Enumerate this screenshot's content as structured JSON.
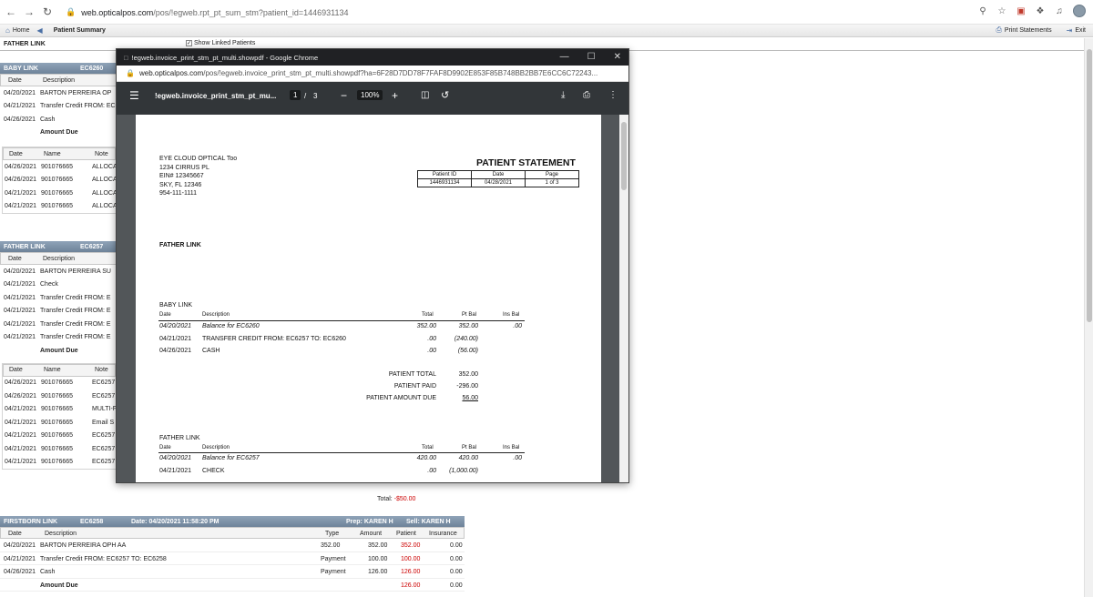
{
  "browser": {
    "url_domain": "web.opticalpos.com",
    "url_path": "/pos/!egweb.rpt_pt_sum_stm?patient_id=1446931134"
  },
  "apptoolbar": {
    "home": "Home",
    "patient_summary": "Patient Summary",
    "print_statements": "Print Statements",
    "exit": "Exit"
  },
  "father_link_bar": {
    "label": "FATHER LINK",
    "show_linked": "Show Linked Patients"
  },
  "left": {
    "baby_title": "BABY LINK",
    "baby_code": "EC6260",
    "col_date": "Date",
    "col_desc": "Description",
    "col_name": "Name",
    "col_note": "Note",
    "baby_rows": [
      {
        "date": "04/20/2021",
        "desc": "BARTON PERREIRA OP"
      },
      {
        "date": "04/21/2021",
        "desc": "Transfer Credit FROM: EC"
      },
      {
        "date": "04/26/2021",
        "desc": "Cash"
      }
    ],
    "amount_due": "Amount Due",
    "baby_pay_rows": [
      {
        "date": "04/26/2021",
        "name": "901076665",
        "note": "ALLOCA"
      },
      {
        "date": "04/26/2021",
        "name": "901076665",
        "note": "ALLOCA"
      },
      {
        "date": "04/21/2021",
        "name": "901076665",
        "note": "ALLOCA"
      },
      {
        "date": "04/21/2021",
        "name": "901076665",
        "note": "ALLOCA"
      }
    ],
    "father_title": "FATHER LINK",
    "father_code": "EC6257",
    "father_rows": [
      {
        "date": "04/20/2021",
        "desc": "BARTON PERREIRA SU"
      },
      {
        "date": "04/21/2021",
        "desc": "Check"
      },
      {
        "date": "04/21/2021",
        "desc": "Transfer Credit FROM: E"
      },
      {
        "date": "04/21/2021",
        "desc": "Transfer Credit FROM: E"
      },
      {
        "date": "04/21/2021",
        "desc": "Transfer Credit FROM: E"
      },
      {
        "date": "04/21/2021",
        "desc": "Transfer Credit FROM: E"
      }
    ],
    "father_pay_rows": [
      {
        "date": "04/26/2021",
        "name": "901076665",
        "note": "EC6257"
      },
      {
        "date": "04/26/2021",
        "name": "901076665",
        "note": "EC6257"
      },
      {
        "date": "04/21/2021",
        "name": "901076665",
        "note": "MULTI-F"
      },
      {
        "date": "04/21/2021",
        "name": "901076665",
        "note": "Email S"
      },
      {
        "date": "04/21/2021",
        "name": "901076665",
        "note": "EC6257"
      },
      {
        "date": "04/21/2021",
        "name": "901076665",
        "note": "EC6257"
      },
      {
        "date": "04/21/2021",
        "name": "901076665",
        "note": "EC6257"
      }
    ]
  },
  "total": {
    "label": "Total:",
    "value": "-$50.00"
  },
  "firstborn": {
    "title": "FIRSTBORN LINK",
    "code": "EC6258",
    "date_label": "Date: 04/20/2021 11:58:20 PM",
    "prep": "Prep: KAREN H",
    "sell": "Sell: KAREN H",
    "cols": {
      "date": "Date",
      "desc": "Description",
      "type": "Type",
      "amount": "Amount",
      "patient": "Patient",
      "insurance": "Insurance"
    },
    "rows": [
      {
        "date": "04/20/2021",
        "desc": "BARTON PERREIRA OPH AA",
        "type": "352.00",
        "amount": "352.00",
        "patient": "352.00",
        "insurance": "0.00"
      },
      {
        "date": "04/21/2021",
        "desc": "Transfer Credit FROM: EC6257 TO: EC6258",
        "type": "Payment",
        "amount": "100.00",
        "patient": "100.00",
        "insurance": "0.00"
      },
      {
        "date": "04/26/2021",
        "desc": "Cash",
        "type": "Payment",
        "amount": "126.00",
        "patient": "126.00",
        "insurance": "0.00"
      }
    ],
    "amount_due": "Amount Due",
    "due_patient": "126.00",
    "due_insurance": "0.00"
  },
  "popup": {
    "title": "!egweb.invoice_print_stm_pt_multi.showpdf - Google Chrome",
    "url_domain": "web.opticalpos.com",
    "url_path": "/pos/!egweb.invoice_print_stm_pt_multi.showpdf?ha=6F28D7DD78F7FAF8D9902E853F85B748BB2BB7E6CC6C72243...",
    "doc_title": "!egweb.invoice_print_stm_pt_mu...",
    "page_current": "1",
    "page_sep": "/",
    "page_total": "3",
    "zoom": "100%"
  },
  "statement": {
    "company": [
      "EYE CLOUD OPTICAL Too",
      "1234 CIRRUS PL",
      "EIN# 12345667",
      "SKY, FL 12346",
      "954-111-1111"
    ],
    "heading": "PATIENT STATEMENT",
    "id_headers": [
      "Patient ID",
      "Date",
      "Page"
    ],
    "id_values": [
      "1446931134",
      "04/28/2021",
      "1 of 3"
    ],
    "father_link": "FATHER LINK",
    "baby_section": "BABY LINK",
    "th": {
      "date": "Date",
      "desc": "Description",
      "total": "Total",
      "ptbal": "Pt Bal",
      "insbal": "Ins Bal"
    },
    "baby_rows": [
      {
        "date": "04/20/2021",
        "desc": "Balance for EC6260",
        "total": "352.00",
        "ptbal": "352.00",
        "insbal": ".00"
      },
      {
        "date": "04/21/2021",
        "desc": "TRANSFER CREDIT FROM: EC6257 TO: EC6260",
        "total": ".00",
        "ptbal": "(240.00)",
        "insbal": ""
      },
      {
        "date": "04/26/2021",
        "desc": "CASH",
        "total": ".00",
        "ptbal": "(56.00)",
        "insbal": ""
      }
    ],
    "patient_total_label": "PATIENT TOTAL",
    "patient_total": "352.00",
    "patient_paid_label": "PATIENT PAID",
    "patient_paid": "-296.00",
    "patient_due_label": "PATIENT AMOUNT DUE",
    "patient_due": "56.00",
    "father_section": "FATHER LINK",
    "father_rows": [
      {
        "date": "04/20/2021",
        "desc": "Balance for EC6257",
        "total": "420.00",
        "ptbal": "420.00",
        "insbal": ".00"
      },
      {
        "date": "04/21/2021",
        "desc": "CHECK",
        "total": ".00",
        "ptbal": "(1,000.00)",
        "insbal": ""
      }
    ]
  }
}
